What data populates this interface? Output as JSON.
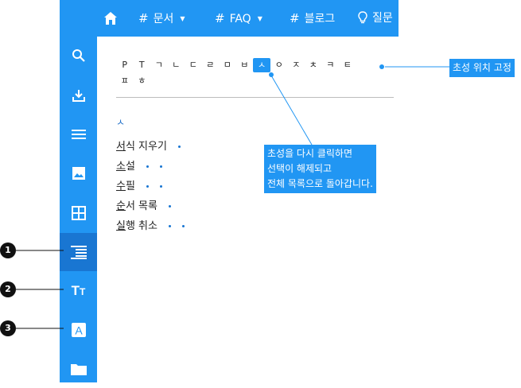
{
  "topbar": {
    "nav": [
      {
        "label": "문서",
        "has_caret": true
      },
      {
        "label": "FAQ",
        "has_caret": true
      },
      {
        "label": "블로그",
        "has_caret": false
      },
      {
        "label": "질문",
        "has_caret": false
      }
    ]
  },
  "sidebar": {
    "icons": [
      "search-icon",
      "download-icon",
      "menu-icon",
      "image-icon",
      "grid-icon",
      "list-align-icon",
      "text-size-icon",
      "font-icon",
      "folder-icon"
    ],
    "active": "list-align-icon"
  },
  "choseong": {
    "row1": [
      "P",
      "T",
      "ㄱ",
      "ㄴ",
      "ㄷ",
      "ㄹ",
      "ㅁ",
      "ㅂ",
      "ㅅ",
      "ㅇ",
      "ㅈ",
      "ㅊ",
      "ㅋ",
      "ㅌ"
    ],
    "row2": [
      "ㅍ",
      "ㅎ"
    ],
    "selected": "ㅅ"
  },
  "section": {
    "heading": "ㅅ",
    "items": [
      {
        "first": "서",
        "rest": "식 지우기",
        "dots": 1
      },
      {
        "first": "소",
        "rest": "설",
        "dots": 2
      },
      {
        "first": "수",
        "rest": "필",
        "dots": 2
      },
      {
        "first": "순",
        "rest": "서 목록",
        "dots": 1
      },
      {
        "first": "실",
        "rest": "행 취소",
        "dots": 2
      }
    ]
  },
  "callouts": {
    "pin_label": "초성 위치 고정",
    "toggle_line1": "초성을 다시 클릭하면",
    "toggle_line2": "선택이 해제되고",
    "toggle_line3": "전체 목록으로 돌아갑니다."
  },
  "badges": [
    "1",
    "2",
    "3"
  ]
}
